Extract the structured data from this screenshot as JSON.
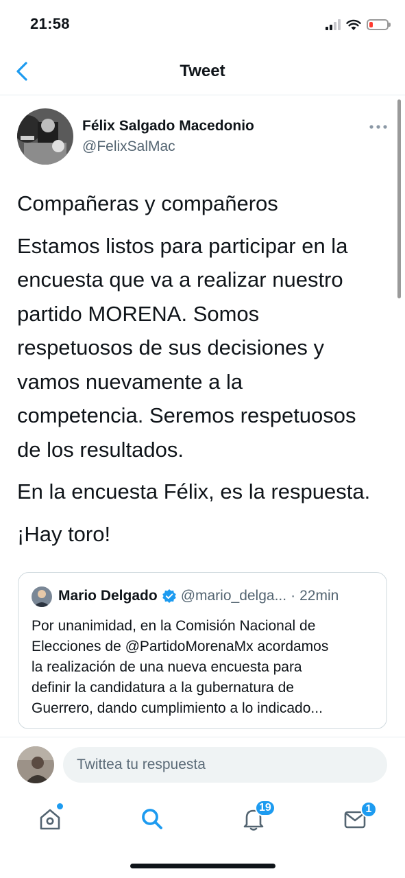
{
  "status_bar": {
    "time": "21:58",
    "signal_icon": "signal-icon",
    "wifi_icon": "wifi-icon",
    "battery_icon": "battery-low-icon"
  },
  "header": {
    "title": "Tweet",
    "back_icon": "chevron-left-icon"
  },
  "tweet": {
    "author": {
      "name": "Félix Salgado Macedonio",
      "handle": "@FelixSalMac"
    },
    "paragraphs": [
      [
        "Compañeras y compañeros"
      ],
      [
        "Estamos listos para participar en la",
        "encuesta que va a realizar nuestro",
        "partido MORENA. Somos",
        "respetuosos de sus decisiones y",
        "vamos nuevamente a la",
        "competencia. Seremos respetuosos",
        "de los resultados."
      ],
      [
        "En la encuesta Félix, es la respuesta."
      ],
      [
        "¡Hay toro!"
      ]
    ]
  },
  "quoted_tweet": {
    "author_name": "Mario Delgado",
    "handle": "@mario_delga...",
    "separator": "·",
    "time": "22min",
    "lines": [
      "Por unanimidad, en la Comisión Nacional de",
      "Elecciones de @PartidoMorenaMx acordamos",
      "la realización de una nueva encuesta para",
      "definir la candidatura a la gubernatura de",
      "Guerrero, dando cumplimiento a lo indicado..."
    ]
  },
  "reply": {
    "placeholder": "Twittea tu respuesta"
  },
  "tab_bar": {
    "notifications_badge": "19",
    "messages_badge": "1"
  },
  "colors": {
    "accent": "#1d9bf0",
    "text": "#0f1419",
    "secondary": "#536471"
  }
}
